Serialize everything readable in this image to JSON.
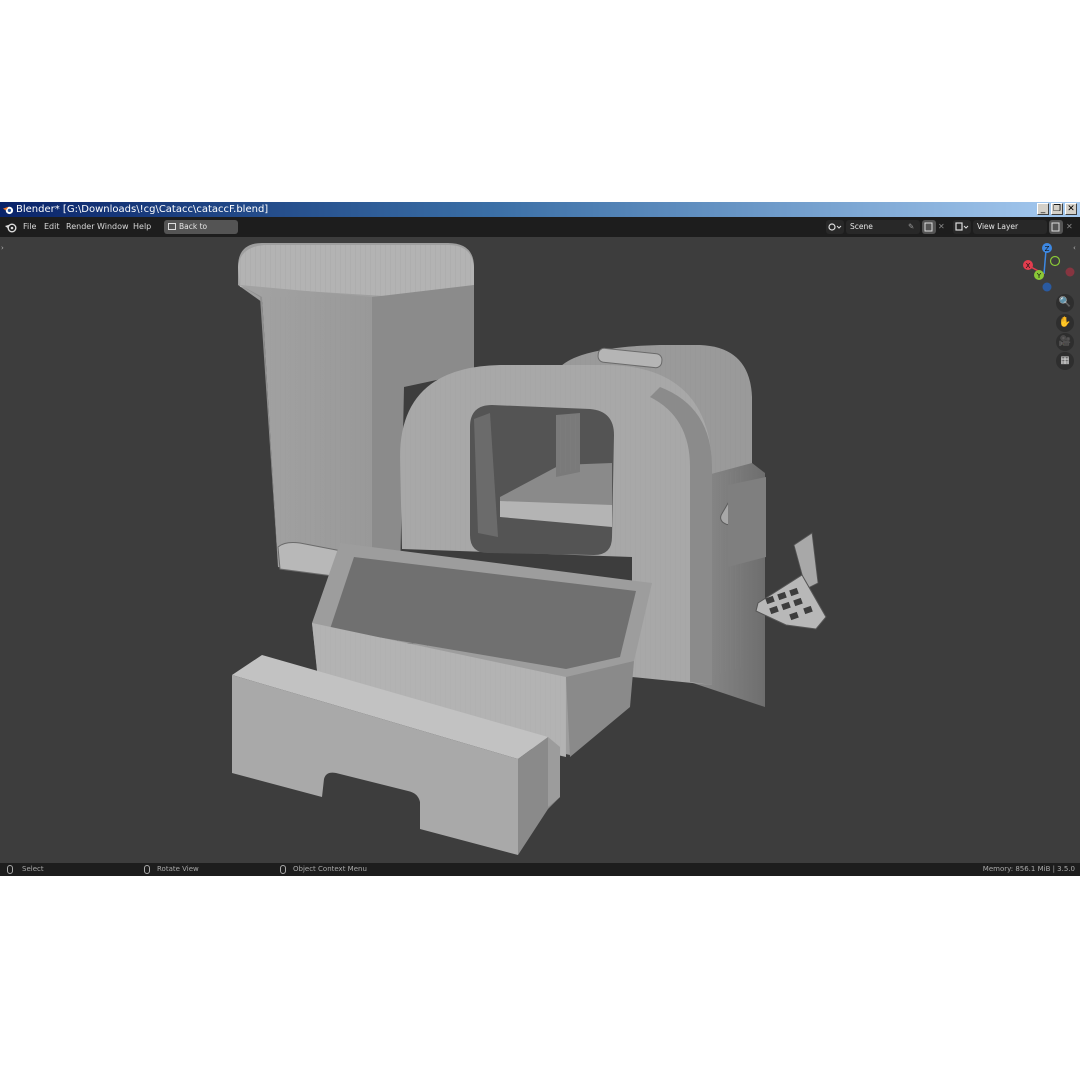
{
  "window": {
    "title": "Blender* [G:\\Downloads\\!cg\\Catacc\\cataccF.blend]",
    "controls": {
      "minimize": "_",
      "restore": "❐",
      "close": "✕"
    }
  },
  "menu": {
    "items": [
      "File",
      "Edit",
      "Render",
      "Window",
      "Help"
    ],
    "back_button": "Back to Previous"
  },
  "scene": {
    "name": "Scene"
  },
  "view_layer": {
    "name": "View Layer"
  },
  "gizmo": {
    "z": "Z",
    "y": "Y",
    "x": "X"
  },
  "status": {
    "select": "Select",
    "rotate": "Rotate View",
    "context": "Object Context Menu",
    "memory": "Memory: 856.1 MiB | 3.5.0"
  },
  "colors": {
    "titlebar_start": "#0a246a",
    "titlebar_end": "#a6caf0",
    "viewport_bg": "#3d3d3d",
    "header_bg": "#1d1d1d",
    "axis_x": "#e33d4e",
    "axis_y": "#8ac837",
    "axis_z": "#3d88e3"
  },
  "icons": [
    "blender-logo",
    "zoom-icon",
    "hand-icon",
    "camera-icon",
    "grid-icon"
  ]
}
